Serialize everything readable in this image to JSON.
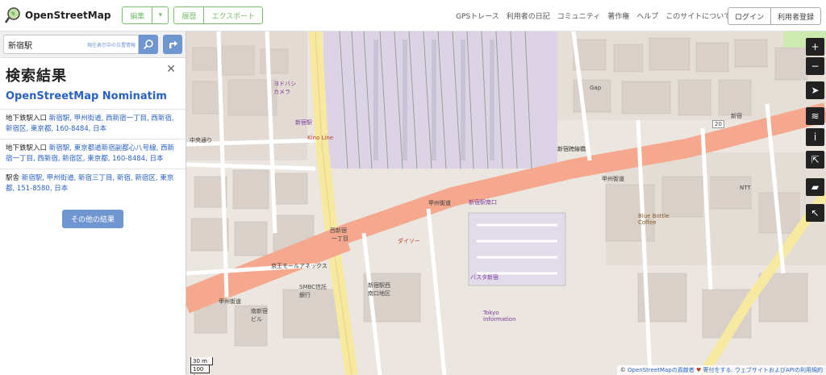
{
  "header": {
    "logo_text": "OpenStreetMap",
    "edit_label": "編集",
    "history_label": "履歴",
    "export_label": "エクスポート",
    "nav": [
      "GPSトレース",
      "利用者の日記",
      "コミュニティ",
      "著作権",
      "ヘルプ",
      "このサイトについて"
    ],
    "login_label": "ログイン",
    "signup_label": "利用者登録",
    "accent_color": "#7ebc6f"
  },
  "search": {
    "value": "新宿駅",
    "where_am_i": "現在表示中の位置情報"
  },
  "results": {
    "title": "検索結果",
    "provider": "OpenStreetMap Nominatim",
    "items": [
      {
        "type": "地下鉄駅入口",
        "link": "新宿駅, 甲州街道, 西新宿一丁目, 西新宿, 新宿区, 東京都, 160-8484, 日本"
      },
      {
        "type": "地下鉄駅入口",
        "link": "新宿駅, 東京都道新宿副都心八号線, 西新宿一丁目, 西新宿, 新宿区, 東京都, 160-8484, 日本"
      },
      {
        "type": "駅舎",
        "link": "新宿駅, 甲州街道, 新宿三丁目, 新宿, 新宿区, 東京都, 151-8580, 日本"
      }
    ],
    "more_label": "その他の結果",
    "close_icon": "close-icon"
  },
  "map": {
    "labels": {
      "shinjuku_bridge": "新宿跨線橋",
      "koshu_1": "甲州街道",
      "koshu_2": "甲州街道",
      "koshu_3": "甲州街道",
      "chuo": "中央通り",
      "nishishinjuku_1": "西新宿",
      "nishishinjuku_1b": "一丁目",
      "shinjuku_sta": "新宿駅",
      "minamiguchi": "新宿駅南口",
      "takashimaya": "新宿駅西\n南口地区",
      "busta": "バスタ新宿",
      "tokyo_info": "Tokyo\nInformation",
      "keio_mall": "京王モールアネックス",
      "route20": "20",
      "shinjuku_p": "新宿",
      "gap": "Gap",
      "blue_bottle": "Blue Bottle\nCoffee",
      "ntt": "NTT",
      "yodobashi": "ヨドバシ\nカメラ",
      "sumitomo": "SMBC信託\n銀行",
      "bldg": "南新宿\nビル",
      "kinokuniya": "Kino Line",
      "daiso": "ダイソー"
    },
    "scale_m": "30 m",
    "scale_ft": "100 ft",
    "attribution_prefix": "© ",
    "attribution_osm": "OpenStreetMapの貢献者",
    "attribution_heart": " ♥ ",
    "attribution_donate": "寄付をする",
    "attribution_terms": "ウェブサイトおよびAPIの利用規約",
    "colors": {
      "primary_road": "#f5a88e",
      "secondary_road": "#f7e9a0",
      "rail": "#9c9c9c",
      "building": "#d9d0c9",
      "platform": "#c8c4d4"
    }
  },
  "controls": [
    "zoom-in-icon",
    "zoom-out-icon",
    "locate-icon",
    "layers-icon",
    "info-icon",
    "share-icon",
    "note-icon",
    "query-icon"
  ]
}
